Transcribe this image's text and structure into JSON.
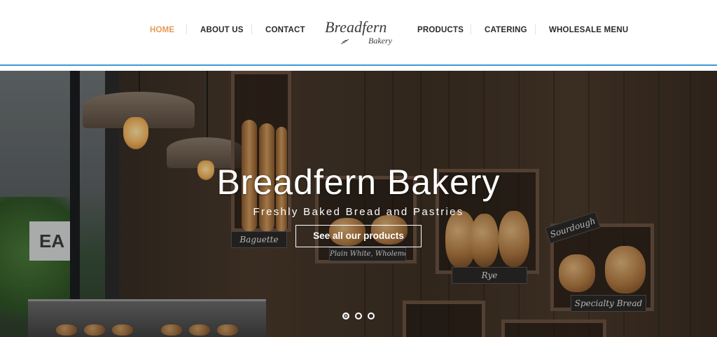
{
  "nav": {
    "left": [
      {
        "label": "HOME",
        "active": true
      },
      {
        "label": "ABOUT US",
        "active": false
      },
      {
        "label": "CONTACT",
        "active": false
      }
    ],
    "right": [
      {
        "label": "PRODUCTS",
        "active": false
      },
      {
        "label": "CATERING",
        "active": false
      },
      {
        "label": "WHOLESALE MENU",
        "active": false
      }
    ]
  },
  "logo": {
    "main": "Breadfern",
    "sub": "Bakery"
  },
  "hero": {
    "title": "Breadfern Bakery",
    "subtitle": "Freshly Baked Bread and Pastries",
    "cta_label": "See all our products",
    "slides_total": 3,
    "active_slide": 1
  },
  "scene_signs": {
    "eat": "EA",
    "baguette": "Baguette",
    "plain": "Plain White, Wholemeal",
    "rye": "Rye",
    "sourdough": "Sourdough",
    "specialty": "Specialty Bread"
  },
  "colors": {
    "accent_active": "#e89a57",
    "nav_text": "#2a2a2a",
    "header_rule": "#3d9ad6"
  },
  "icons": {
    "carousel_dot": "circle-dot-icon",
    "logo_sprig": "wheat-sprig-icon"
  }
}
